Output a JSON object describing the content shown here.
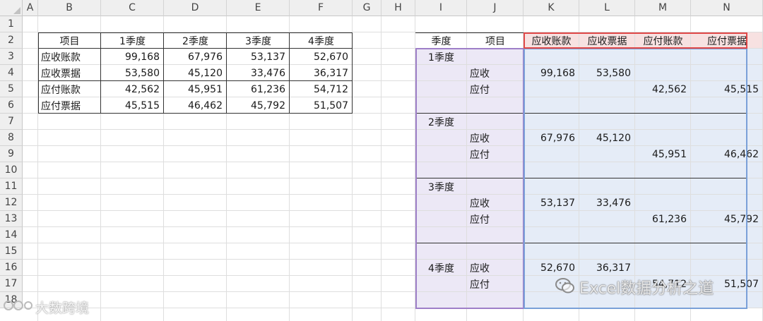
{
  "columns": [
    "A",
    "B",
    "C",
    "D",
    "E",
    "F",
    "G",
    "H",
    "I",
    "J",
    "K",
    "L",
    "M",
    "N"
  ],
  "rows": [
    "1",
    "2",
    "3",
    "4",
    "5",
    "6",
    "7",
    "8",
    "9",
    "10",
    "11",
    "12",
    "13",
    "14",
    "15",
    "16",
    "17",
    "18"
  ],
  "left_table": {
    "headers": [
      "项目",
      "1季度",
      "2季度",
      "3季度",
      "4季度"
    ],
    "rows": [
      [
        "应收账款",
        "99,168",
        "67,976",
        "53,137",
        "52,670"
      ],
      [
        "应收票据",
        "53,580",
        "45,120",
        "33,476",
        "36,317"
      ],
      [
        "应付账款",
        "42,562",
        "45,951",
        "61,236",
        "54,712"
      ],
      [
        "应付票据",
        "45,515",
        "46,462",
        "45,792",
        "51,507"
      ]
    ]
  },
  "right_table": {
    "headers": [
      "季度",
      "项目",
      "应收账款",
      "应收票据",
      "应付账款",
      "应付票据"
    ],
    "quarters": [
      "1季度",
      "2季度",
      "3季度",
      "4季度"
    ],
    "rows": [
      [
        "1季度",
        "",
        "",
        "",
        "",
        ""
      ],
      [
        "",
        "应收",
        "99,168",
        "53,580",
        "",
        ""
      ],
      [
        "",
        "应付",
        "",
        "",
        "42,562",
        "45,515"
      ],
      [
        "",
        "",
        "",
        "",
        "",
        ""
      ],
      [
        "2季度",
        "",
        "",
        "",
        "",
        ""
      ],
      [
        "",
        "应收",
        "67,976",
        "45,120",
        "",
        ""
      ],
      [
        "",
        "应付",
        "",
        "",
        "45,951",
        "46,462"
      ],
      [
        "",
        "",
        "",
        "",
        "",
        ""
      ],
      [
        "3季度",
        "",
        "",
        "",
        "",
        ""
      ],
      [
        "",
        "应收",
        "53,137",
        "33,476",
        "",
        ""
      ],
      [
        "",
        "应付",
        "",
        "",
        "61,236",
        "45,792"
      ],
      [
        "",
        "",
        "",
        "",
        "",
        ""
      ],
      [
        "",
        "",
        "",
        "",
        "",
        ""
      ],
      [
        "4季度",
        "应收",
        "52,670",
        "36,317",
        "",
        ""
      ],
      [
        "",
        "应付",
        "",
        "",
        "54,712",
        "51,507"
      ],
      [
        "",
        "",
        "",
        "",
        "",
        ""
      ]
    ]
  },
  "watermarks": {
    "wechat": "Excel数据分析之道",
    "weibo": "大数跨境"
  },
  "colors": {
    "header_bg": "#efefef",
    "grid": "#dedede",
    "purple_fill": "#ece8f6",
    "purple_border": "#9e7fc8",
    "blue_fill": "#e5ecf7",
    "blue_border": "#7aa0d8",
    "red_fill": "#f7e1e1",
    "red_border": "#e04848"
  }
}
